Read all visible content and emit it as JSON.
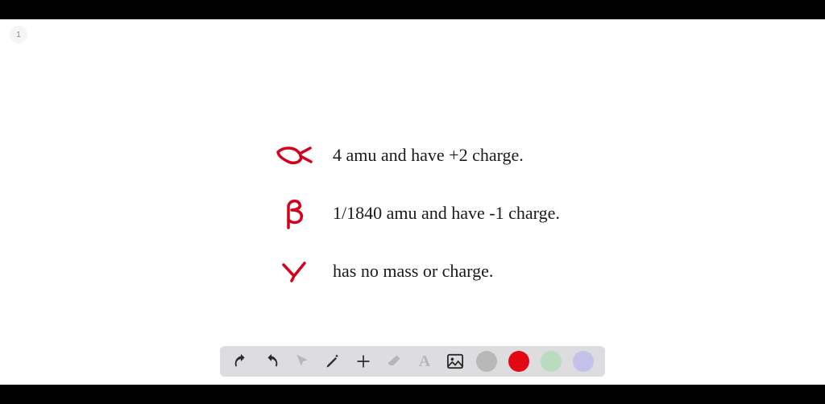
{
  "page_number": "1",
  "content": {
    "rows": [
      {
        "symbol": "alpha",
        "text": "4 amu and have +2 charge."
      },
      {
        "symbol": "beta",
        "text": "1/1840 amu and have -1 charge."
      },
      {
        "symbol": "gamma",
        "text": "has no mass or charge."
      }
    ]
  },
  "toolbar": {
    "tools": {
      "undo": "undo",
      "redo": "redo",
      "pointer": "pointer",
      "pencil": "pencil",
      "plus": "plus",
      "eraser": "eraser",
      "text": "text",
      "image": "image"
    },
    "colors": {
      "gray": "#b8b8b8",
      "red": "#e30613",
      "green": "#b9dcc0",
      "purple": "#c3c1ea"
    }
  },
  "stroke_color": "#d3001b"
}
